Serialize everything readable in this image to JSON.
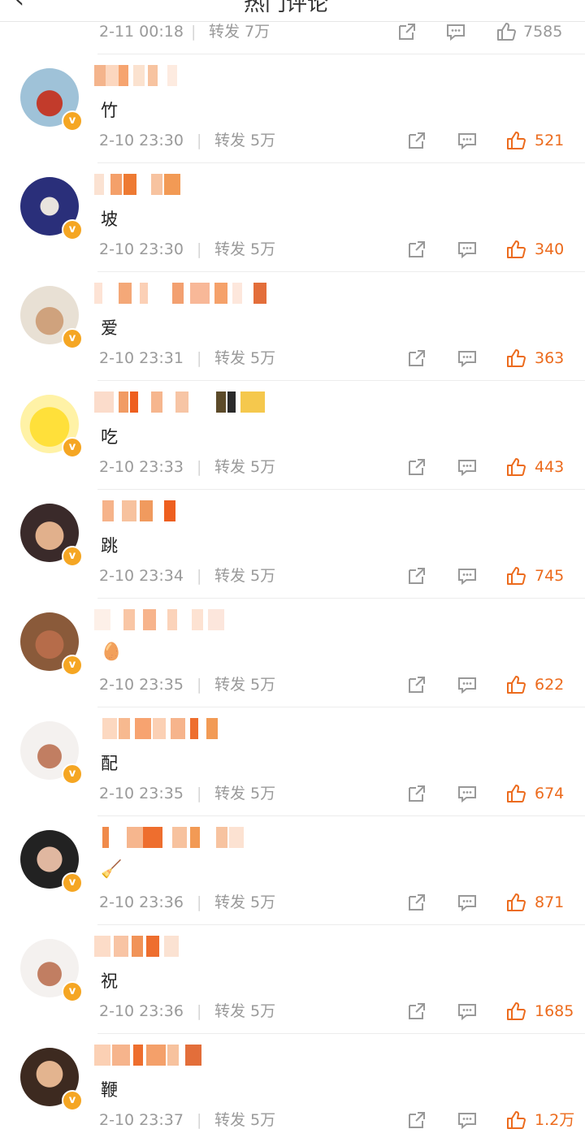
{
  "header": {
    "back_icon": "chevron-left-icon",
    "title": "热门评论"
  },
  "top_partial": {
    "time": "2-11 00:18",
    "repost": "转发 7万",
    "likes": "7585"
  },
  "colors": {
    "accent": "#ec6b1d",
    "meta": "#9a9a9a",
    "like_active": "#ec6b1d"
  },
  "comments": [
    {
      "text": "竹",
      "time": "2-10 23:30",
      "repost": "转发 5万",
      "likes": "521"
    },
    {
      "text": "坡",
      "time": "2-10 23:30",
      "repost": "转发 5万",
      "likes": "340"
    },
    {
      "text": "爱",
      "time": "2-10 23:31",
      "repost": "转发 5万",
      "likes": "363"
    },
    {
      "text": "吃",
      "time": "2-10 23:33",
      "repost": "转发 5万",
      "likes": "443"
    },
    {
      "text": "跳",
      "time": "2-10 23:34",
      "repost": "转发 5万",
      "likes": "745"
    },
    {
      "text": "🥚",
      "time": "2-10 23:35",
      "repost": "转发 5万",
      "likes": "622"
    },
    {
      "text": "配",
      "time": "2-10 23:35",
      "repost": "转发 5万",
      "likes": "674"
    },
    {
      "text": "🧹",
      "time": "2-10 23:36",
      "repost": "转发 5万",
      "likes": "871"
    },
    {
      "text": "祝",
      "time": "2-10 23:36",
      "repost": "转发 5万",
      "likes": "1685"
    },
    {
      "text": "鞭",
      "time": "2-10 23:37",
      "repost": "转发 5万",
      "likes": "1.2万"
    }
  ]
}
